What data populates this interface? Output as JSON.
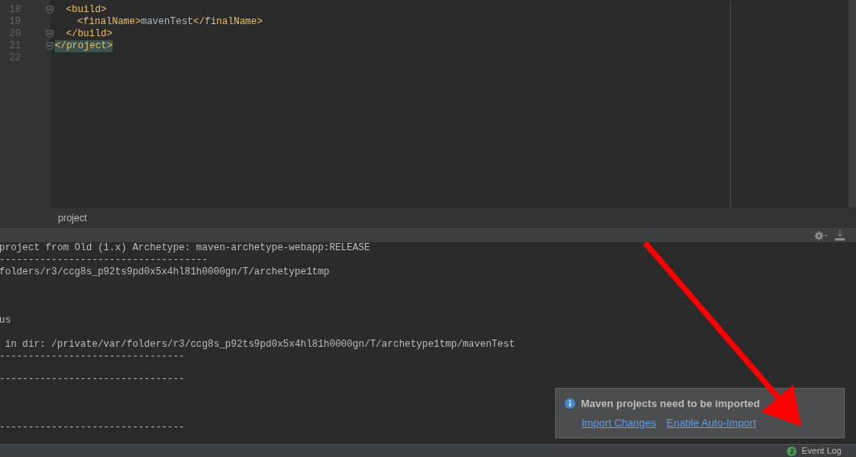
{
  "editor": {
    "lines": [
      {
        "number": "18",
        "text": "<build>",
        "fold_marker": true,
        "highlighted": false
      },
      {
        "number": "19",
        "text": "<finalName>mavenTest</finalName>",
        "fold_marker": false,
        "highlighted": false
      },
      {
        "number": "20",
        "text": "</build>",
        "fold_marker": true,
        "highlighted": false
      },
      {
        "number": "21",
        "text": "</project>",
        "fold_marker": true,
        "highlighted": true
      },
      {
        "number": "22"
      }
    ],
    "breadcrumb": "project"
  },
  "console": {
    "lines": [
      "project from Old (1.x) Archetype: maven-archetype-webapp:RELEASE",
      "------------------------------------",
      "folders/r3/ccg8s_p92ts9pd0x5x4hl81h0000gn/T/archetype1tmp",
      "us",
      " in dir: /private/var/folders/r3/ccg8s_p92ts9pd0x5x4hl81h0000gn/T/archetype1tmp/mavenTest",
      "--------------------------------",
      "--------------------------------",
      "--------------------------------"
    ]
  },
  "notification": {
    "message": "Maven projects need to be imported",
    "links": [
      "Import Changes",
      "Enable Auto-Import"
    ]
  },
  "status_bar": {
    "badge": "2",
    "event_log": "Event Log"
  }
}
